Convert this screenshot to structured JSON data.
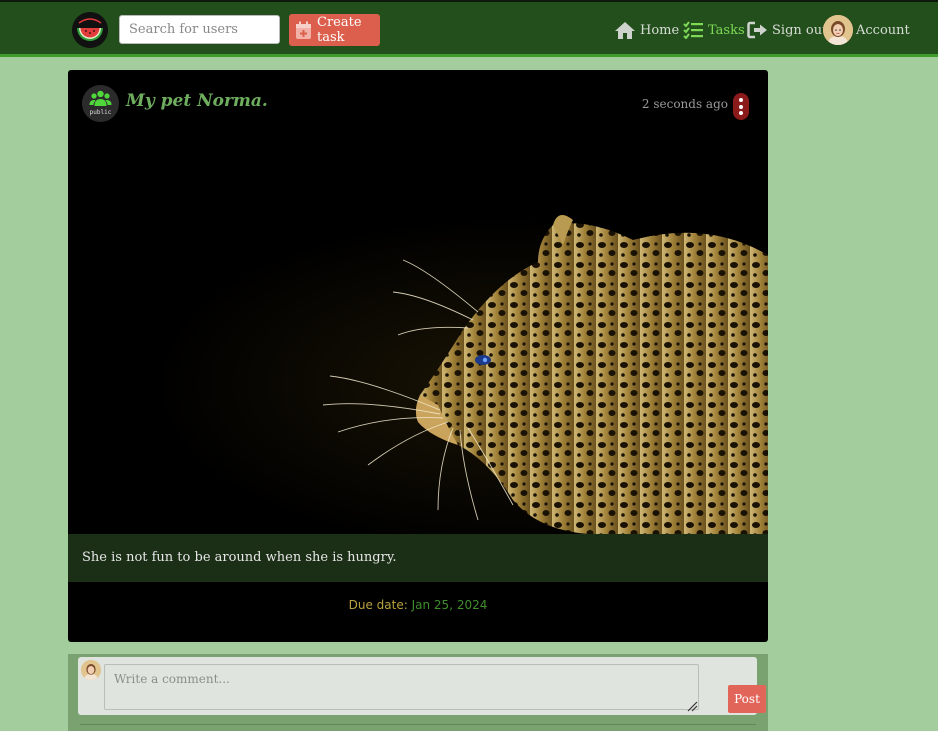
{
  "nav": {
    "search_placeholder": "Search for users",
    "create_task_label": "Create task",
    "home_label": "Home",
    "tasks_label": "Tasks",
    "signout_label": "Sign out",
    "account_label": "Account",
    "active_color": "#7ed957",
    "bar_color": "#234f1c"
  },
  "post": {
    "title": "My pet Norma.",
    "visibility_badge": "public",
    "timestamp": "2 seconds ago",
    "image_subject": "leopard-profile",
    "caption": "She is not fun to be around when she is hungry.",
    "due_label": "Due date:",
    "due_value": "Jan 25, 2024"
  },
  "comments": {
    "placeholder": "Write a comment...",
    "post_label": "Post"
  }
}
